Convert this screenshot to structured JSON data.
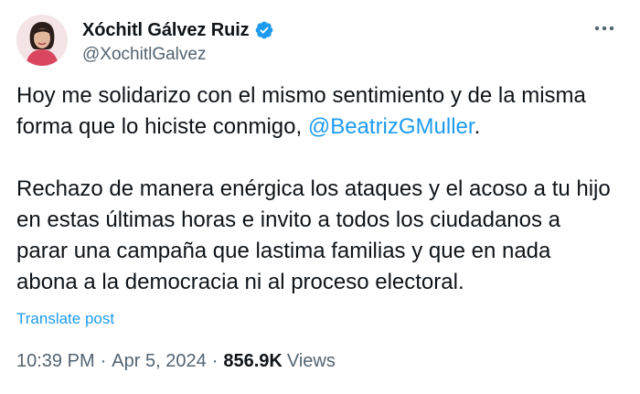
{
  "tweet": {
    "author": {
      "display_name": "Xóchitl Gálvez Ruiz",
      "handle": "@XochitlGalvez",
      "verified_icon": "verified-badge-icon",
      "verified_color": "#1d9bf0"
    },
    "more_icon": "more-icon",
    "text": {
      "p1_before": "Hoy me solidarizo con el mismo sentimiento y de la misma",
      "p1_line2_before": "forma que lo hiciste conmigo, ",
      "mention": "@BeatrizGMuller",
      "p1_after": ".",
      "p2_line1": "Rechazo de manera enérgica los ataques y el acoso a tu hijo",
      "p2_line2": "en estas últimas horas e invito a todos los ciudadanos a",
      "p2_line3": "parar una campaña que lastima familias y que en nada",
      "p2_line4": "abona a la democracia ni al proceso electoral."
    },
    "translate_label": "Translate post",
    "time": "10:39 PM",
    "separator": "·",
    "date": "Apr 5, 2024",
    "views_count": "856.9K",
    "views_label": "Views",
    "colors": {
      "text": "#0f1419",
      "secondary": "#536471",
      "link": "#1d9bf0"
    }
  }
}
